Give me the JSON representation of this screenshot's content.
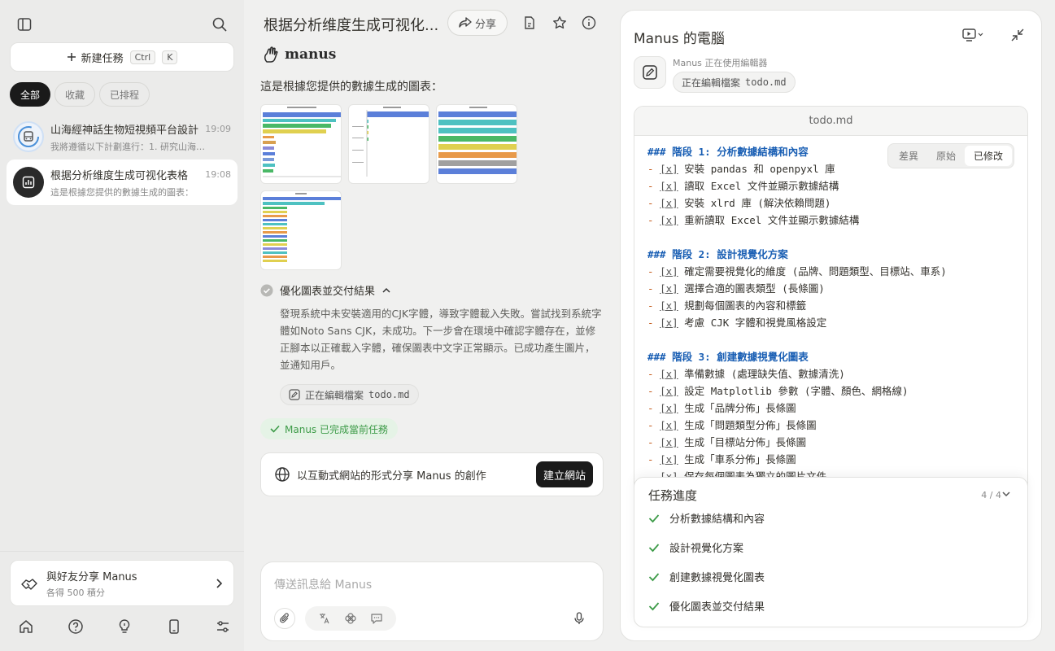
{
  "sidebar": {
    "new_task_label": "新建任務",
    "shortcut_ctrl": "Ctrl",
    "shortcut_key": "K",
    "filters": [
      "全部",
      "收藏",
      "已排程"
    ],
    "tasks": [
      {
        "title": "山海經神話生物短視頻平台設計",
        "preview": "我將遵循以下計劃進行：1. 研究山海經神話生物",
        "time": "19:09"
      },
      {
        "title": "根据分析维度生成可视化表格",
        "preview": "這是根據您提供的數據生成的圖表：",
        "time": "19:08"
      }
    ],
    "share_title": "與好友分享 Manus",
    "share_sub": "各得 500 積分"
  },
  "main": {
    "title": "根据分析维度生成可视化...",
    "share_label": "分享",
    "logo_text": "manus",
    "intro": "這是根據您提供的數據生成的圖表：",
    "step_title": "優化圖表並交付結果",
    "step_desc": "發現系統中未安裝適用的CJK字體，導致字體載入失敗。嘗試找到系統字體如Noto Sans CJK，未成功。下一步會在環境中確認字體存在，並修正腳本以正確載入字體，確保圖表中文字正常顯示。已成功產生圖片，並通知用戶。",
    "tool_label": "正在編輯檔案",
    "tool_file": "todo.md",
    "done_label": "Manus 已完成當前任務",
    "web_text": "以互動式網站的形式分享 Manus 的創作",
    "web_button": "建立網站",
    "input_placeholder": "傳送訊息給 Manus"
  },
  "computer": {
    "title": "Manus 的電腦",
    "agent_status": "Manus 正在使用編輯器",
    "agent_action": "正在編輯檔案",
    "agent_file": "todo.md",
    "editor_filename": "todo.md",
    "tabs": [
      "差異",
      "原始",
      "已修改"
    ],
    "active_tab": "已修改",
    "lines": [
      {
        "t": "h",
        "text": "### 階段 1: 分析數據結構和內容"
      },
      {
        "t": "i",
        "text": "安裝 pandas 和 openpyxl 庫"
      },
      {
        "t": "i",
        "text": "讀取 Excel 文件並顯示數據結構"
      },
      {
        "t": "i",
        "text": "安裝 xlrd 庫 (解決依賴問題)"
      },
      {
        "t": "i",
        "text": "重新讀取 Excel 文件並顯示數據結構"
      },
      {
        "t": "b",
        "text": ""
      },
      {
        "t": "h",
        "text": "### 階段 2: 設計視覺化方案"
      },
      {
        "t": "i",
        "text": "確定需要視覺化的維度 (品牌、問題類型、目標站、車系)"
      },
      {
        "t": "i",
        "text": "選擇合適的圖表類型 (長條圖)"
      },
      {
        "t": "i",
        "text": "規劃每個圖表的內容和標籤"
      },
      {
        "t": "i",
        "text": "考慮 CJK 字體和視覺風格設定"
      },
      {
        "t": "b",
        "text": ""
      },
      {
        "t": "h",
        "text": "### 階段 3: 創建數據視覺化圖表"
      },
      {
        "t": "i",
        "text": "準備數據 (處理缺失值、數據清洗)"
      },
      {
        "t": "i",
        "text": "設定 Matplotlib 參數 (字體、顏色、網格線)"
      },
      {
        "t": "i",
        "text": "生成「品牌分佈」長條圖"
      },
      {
        "t": "i",
        "text": "生成「問題類型分佈」長條圖"
      },
      {
        "t": "i",
        "text": "生成「目標站分佈」長條圖"
      },
      {
        "t": "i",
        "text": "生成「車系分佈」長條圖"
      },
      {
        "t": "i",
        "text": "保存每個圖表為獨立的圖片文件"
      }
    ],
    "check_mark": "[x]",
    "dash": "-",
    "progress_title": "任務進度",
    "progress_count": "4 / 4",
    "progress_items": [
      "分析數據結構和內容",
      "設計視覺化方案",
      "創建數據視覺化圖表",
      "優化圖表並交付結果"
    ]
  },
  "colors": {
    "accent_blue": "#1a5fb4",
    "done_green": "#3d9b48",
    "dark": "#1a1a1a"
  }
}
